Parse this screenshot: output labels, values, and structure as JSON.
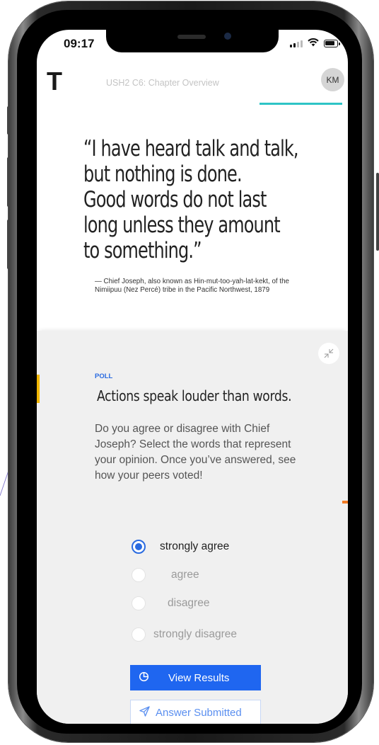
{
  "status_bar": {
    "time": "09:17"
  },
  "header": {
    "logo": "T",
    "title": "USH2 C6: Chapter Overview",
    "avatar_initials": "KM"
  },
  "quote": {
    "lines": [
      "“I have heard talk and talk,",
      " but nothing is done.",
      " Good words do not last",
      " long unless they amount",
      " to something.”"
    ],
    "attribution": "— Chief Joseph, also known as Hin-mut-too-yah-lat-kekt, of the Nimiipuu (Nez Percé) tribe in the Pacific Northwest, 1879"
  },
  "poll": {
    "label": "POLL",
    "heading": "Actions speak louder than words.",
    "prompt": "Do you agree or disagree with Chief Joseph? Select the words that represent your opinion.  Once you’ve answered, see how your peers voted!",
    "options": [
      {
        "label": "strongly agree",
        "selected": true
      },
      {
        "label": "agree",
        "selected": false
      },
      {
        "label": "disagree",
        "selected": false
      },
      {
        "label": "strongly disagree",
        "selected": false
      }
    ],
    "view_results_label": "View Results",
    "submitted_label": "Answer Submitted"
  },
  "icons": {
    "collapse": "collapse-icon",
    "results": "pie-chart-icon",
    "submitted": "send-icon"
  },
  "colors": {
    "accent_blue": "#1f66f0",
    "progress_teal": "#2ec4c6",
    "accent_yellow": "#f2b700",
    "accent_orange": "#f07a24"
  }
}
